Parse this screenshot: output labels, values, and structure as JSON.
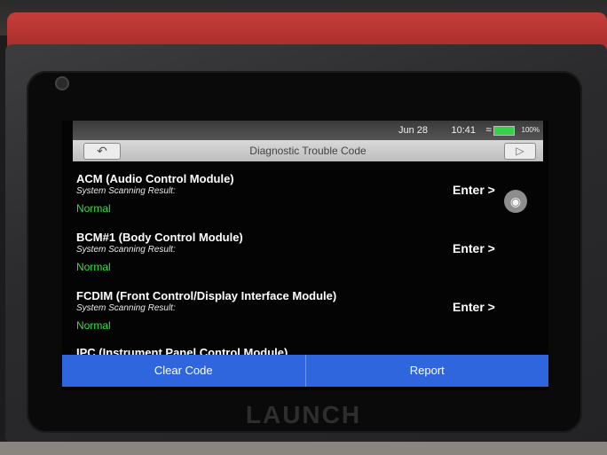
{
  "device": {
    "brand": "LAUNCH"
  },
  "statusbar": {
    "date": "Jun 28",
    "time": "10:41",
    "battery_pct": "100%"
  },
  "titlebar": {
    "title": "Diagnostic Trouble Code"
  },
  "modules": [
    {
      "name": "ACM (Audio Control Module)",
      "sub": "System Scanning Result:",
      "result": "Normal",
      "enter": "Enter >"
    },
    {
      "name": "BCM#1 (Body Control Module)",
      "sub": "System Scanning Result:",
      "result": "Normal",
      "enter": "Enter >"
    },
    {
      "name": "FCDIM (Front Control/Display Interface Module)",
      "sub": "System Scanning Result:",
      "result": "Normal",
      "enter": "Enter >"
    },
    {
      "name": "IPC (Instrument Panel Control Module)"
    }
  ],
  "actions": {
    "clear_code": "Clear Code",
    "report": "Report"
  },
  "icons": {
    "back": "back-arrow-icon",
    "exit": "exit-icon",
    "camera": "camera-icon",
    "wifi": "wifi-icon",
    "battery": "battery-icon"
  },
  "colors": {
    "accent": "#2f66de",
    "status_ok": "#2ee33a",
    "device_red": "#c63d3a"
  }
}
